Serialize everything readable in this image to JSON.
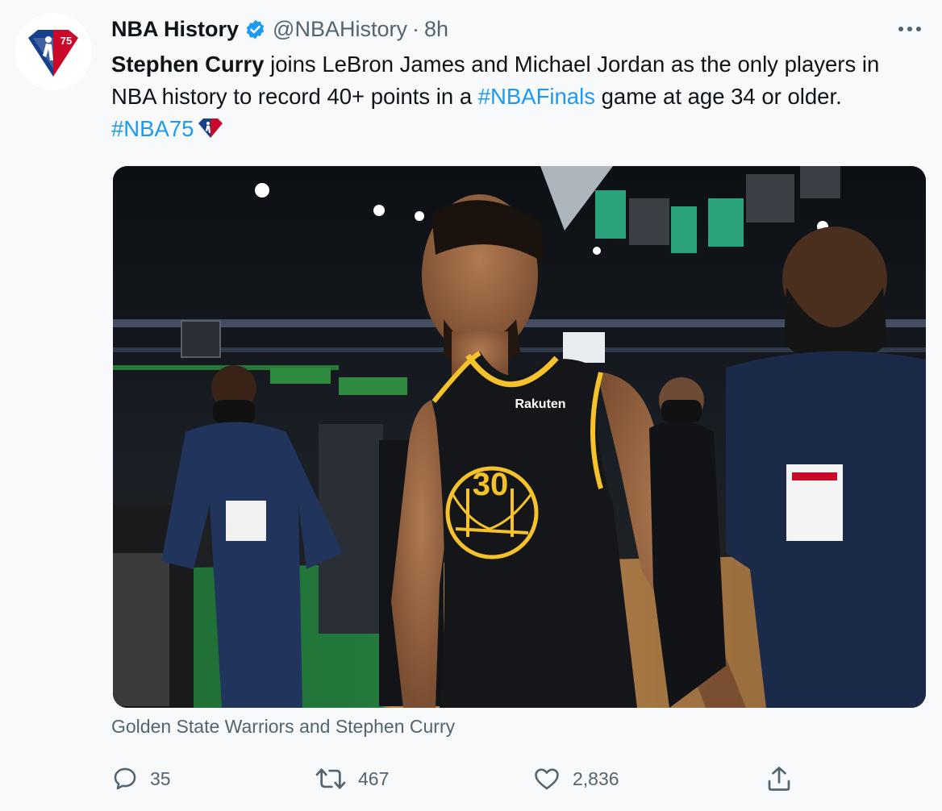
{
  "tweet": {
    "display_name": "NBA History",
    "handle": "@NBAHistory",
    "separator": "·",
    "time": "8h",
    "text_parts": {
      "bold": "Stephen Curry",
      "t1": " joins LeBron James and Michael Jordan as the only players in NBA history to record 40+ points in a ",
      "hashtag1": "#NBAFinals",
      "t2": " game at age 34 or older. ",
      "hashtag2": "#NBA75"
    },
    "image": {
      "jersey_brand": "Rakuten",
      "jersey_number": "30"
    },
    "caption": "Golden State Warriors and Stephen Curry",
    "counts": {
      "replies": "35",
      "retweets": "467",
      "likes": "2,836"
    }
  },
  "avatar_logo_text": "75",
  "colors": {
    "link": "#1d9bf0",
    "secondary": "#536471",
    "verified": "#1d9bf0",
    "nba_red": "#c9082a",
    "nba_blue": "#17408b"
  },
  "icons": [
    "more-icon",
    "verified-badge-icon",
    "nba75-logo-icon",
    "reply-icon",
    "retweet-icon",
    "like-icon",
    "share-icon"
  ]
}
